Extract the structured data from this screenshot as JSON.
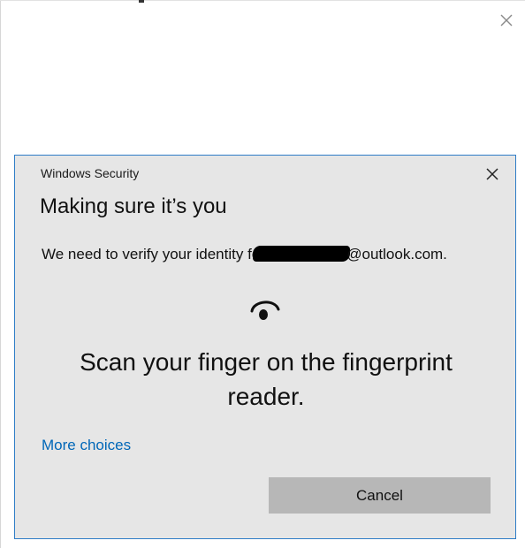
{
  "background_window": {
    "close_icon": "close-icon"
  },
  "dialog": {
    "window_title": "Windows Security",
    "close_icon": "close-icon",
    "heading": "Making sure it’s you",
    "verify_prefix": "We need to verify your identity fo",
    "email_domain": "@outlook.com.",
    "fingerprint_icon": "fingerprint-icon",
    "scan_instruction": "Scan your finger on the fingerprint reader.",
    "more_choices_label": "More choices",
    "cancel_label": "Cancel"
  },
  "colors": {
    "dialog_background": "#e6e6e6",
    "dialog_border": "#2f7dc7",
    "link": "#0067b8",
    "button": "#b7b7b7"
  }
}
